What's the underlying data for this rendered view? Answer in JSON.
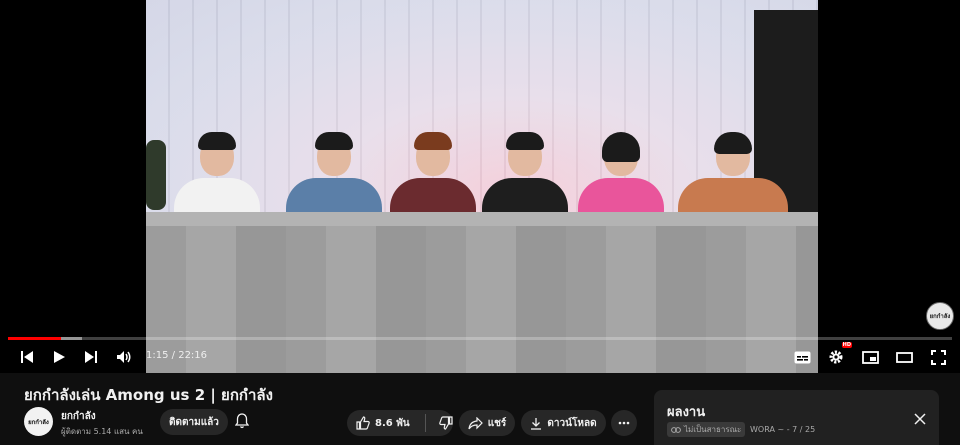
{
  "player": {
    "time_current": "1:15",
    "time_separator": " / ",
    "time_total": "22:16",
    "progress_played": 0.056,
    "progress_loaded": 0.078,
    "hd_badge": "HD",
    "channel_watermark": "ยกกำลัง"
  },
  "video": {
    "title": "ยกกำลังเล่น Among us 2 | ยกกำลัง"
  },
  "channel": {
    "name": "ยกกำลัง",
    "subscribers": "ผู้ติดตาม 5.14 แสน คน",
    "avatar_text": "ยกกำลัง"
  },
  "actions": {
    "subscribed_label": "ติดตามแล้ว",
    "like_count": "8.6 พัน",
    "share_label": "แชร์",
    "download_label": "ดาวน์โหลด"
  },
  "playlist_panel": {
    "title": "ผลงาน",
    "privacy_label": "ไม่เป็นสาธารณะ",
    "meta": "WORA ~ - 7 / 25"
  },
  "colors": {
    "accent_red": "#ff0000",
    "background": "#0f0f0f",
    "pill_bg": "#272727"
  },
  "icons": [
    "previous-icon",
    "play-icon",
    "next-icon",
    "volume-icon",
    "subtitles-icon",
    "settings-icon",
    "miniplayer-icon",
    "theater-icon",
    "fullscreen-icon",
    "bell-icon",
    "like-icon",
    "dislike-icon",
    "share-icon",
    "download-icon",
    "more-icon",
    "close-icon",
    "link-icon"
  ]
}
